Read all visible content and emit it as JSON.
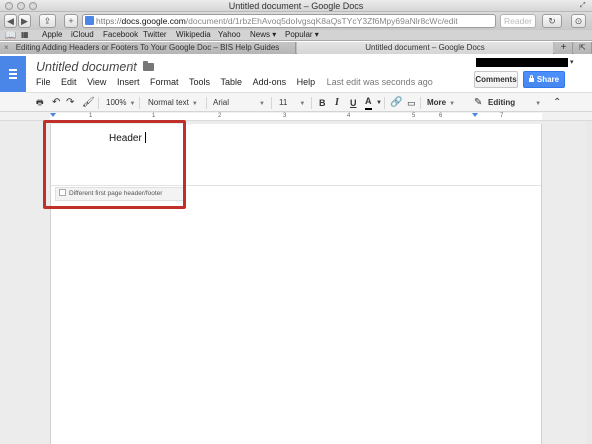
{
  "window": {
    "title": "Untitled document – Google Docs"
  },
  "browser": {
    "url_protocol": "https://",
    "url_domain": "docs.google.com",
    "url_path": "/document/d/1rbzEhAvoq5doIvgsqK8aQsTYcY3Zf6Mpy69aNlr8cWc/edit",
    "reader_label": "Reader",
    "bookmarks": [
      "Apple",
      "iCloud",
      "Facebook",
      "Twitter",
      "Wikipedia",
      "Yahoo",
      "News ▾",
      "Popular ▾"
    ],
    "tabs": [
      {
        "label": "Editing Adding Headers or Footers To Your Google Doc – BIS Help Guides",
        "active": false
      },
      {
        "label": "Untitled document – Google Docs",
        "active": true
      }
    ]
  },
  "docs": {
    "doc_title": "Untitled document",
    "menu": [
      "File",
      "Edit",
      "View",
      "Insert",
      "Format",
      "Tools",
      "Table",
      "Add-ons",
      "Help"
    ],
    "last_edit": "Last edit was seconds ago",
    "comments_label": "Comments",
    "share_label": "Share",
    "toolbar": {
      "zoom": "100%",
      "style": "Normal text",
      "font": "Arial",
      "size": "11",
      "bold": "B",
      "italic": "I",
      "underline": "U",
      "text_color": "A",
      "more": "More",
      "mode": "Editing"
    },
    "ruler_numbers": [
      "1",
      "1",
      "2",
      "3",
      "4",
      "5",
      "6",
      "7"
    ],
    "header_text": "Header",
    "different_first_page": "Different first page header/footer"
  },
  "colors": {
    "brand_blue": "#4a86e8",
    "share_blue": "#4d90fe",
    "highlight_red": "#c0302a"
  }
}
